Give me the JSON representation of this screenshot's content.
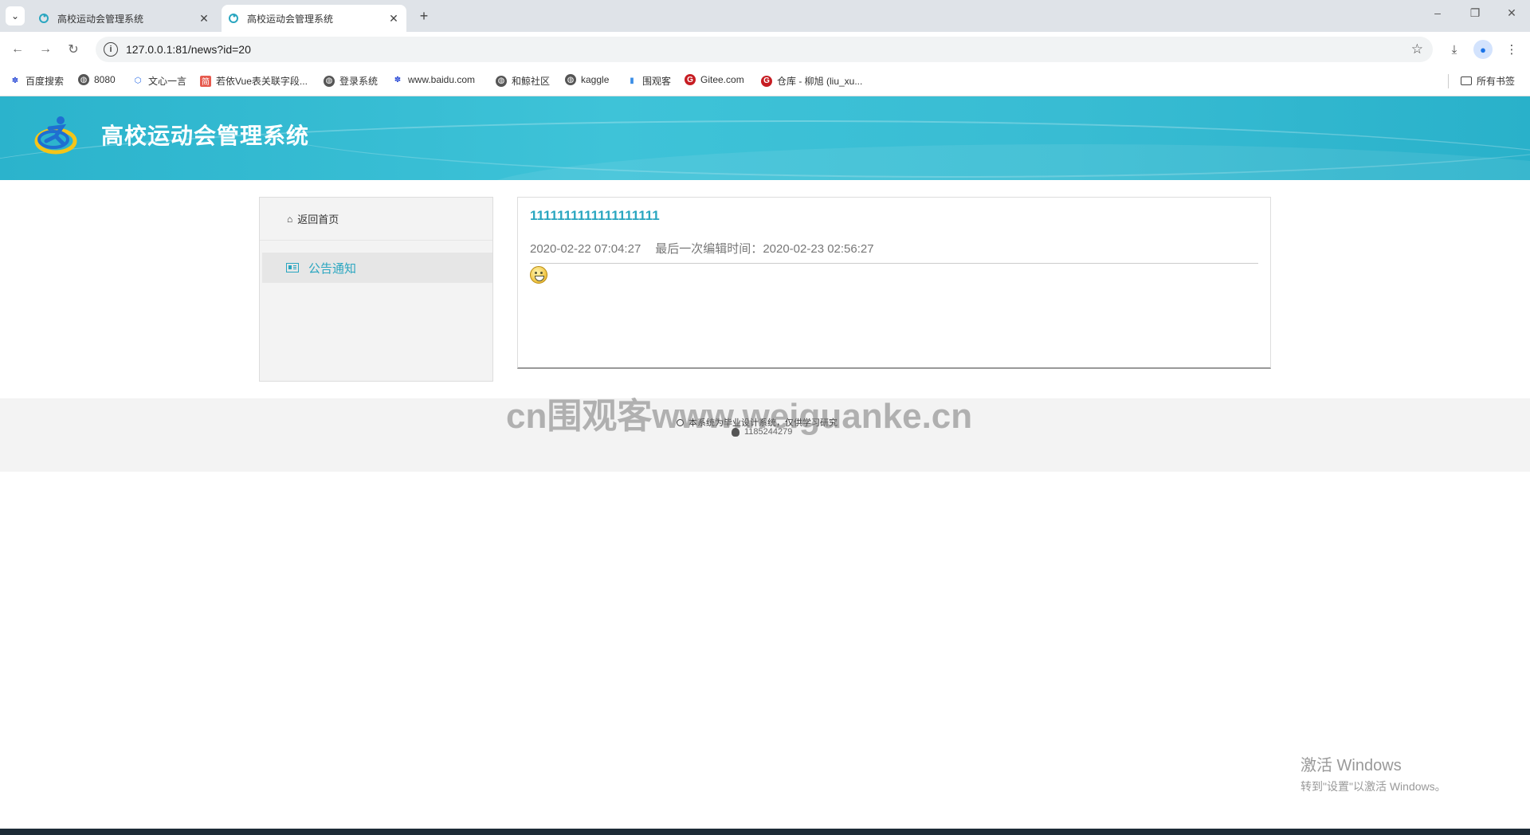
{
  "browser": {
    "tabs": [
      {
        "title": "高校运动会管理系统",
        "active": false
      },
      {
        "title": "高校运动会管理系统",
        "active": true
      }
    ],
    "new_tab_icon": "plus-icon",
    "url": "127.0.0.1:81/news?id=20",
    "bookmarks": [
      {
        "label": "百度搜索",
        "icon": "baidu-paw-icon"
      },
      {
        "label": "8080",
        "icon": "globe-icon"
      },
      {
        "label": "文心一言",
        "icon": "wenxin-icon"
      },
      {
        "label": "若依Vue表关联字段...",
        "icon": "jianshu-icon"
      },
      {
        "label": "登录系统",
        "icon": "globe-icon"
      },
      {
        "label": "www.baidu.com",
        "icon": "baidu-paw-icon"
      },
      {
        "label": "和鲸社区",
        "icon": "globe-icon"
      },
      {
        "label": "kaggle",
        "icon": "globe-icon"
      },
      {
        "label": "围观客",
        "icon": "bookmark-flag-icon"
      },
      {
        "label": "Gitee.com",
        "icon": "gitee-icon"
      },
      {
        "label": "仓库 - 柳旭 (liu_xu...",
        "icon": "gitee-icon"
      }
    ],
    "all_bookmarks_label": "所有书签"
  },
  "site": {
    "title": "高校运动会管理系统"
  },
  "sidebar": {
    "home_label": "返回首页",
    "notice_label": "公告通知"
  },
  "article": {
    "title": "1111111111111111111",
    "created": "2020-02-22 07:04:27",
    "edited_label": "最后一次编辑时间：",
    "edited": "2020-02-23 02:56:27"
  },
  "footer": {
    "watermark": "cn围观客www.weiguanke.cn",
    "notice": "本系统为毕业设计系统，仅供学习研究",
    "qq": "1185244279"
  },
  "os": {
    "activate_title": "激活 Windows",
    "activate_sub": "转到\"设置\"以激活 Windows。"
  },
  "colors": {
    "accent": "#2aa6c0",
    "banner": "#38bcd3"
  }
}
